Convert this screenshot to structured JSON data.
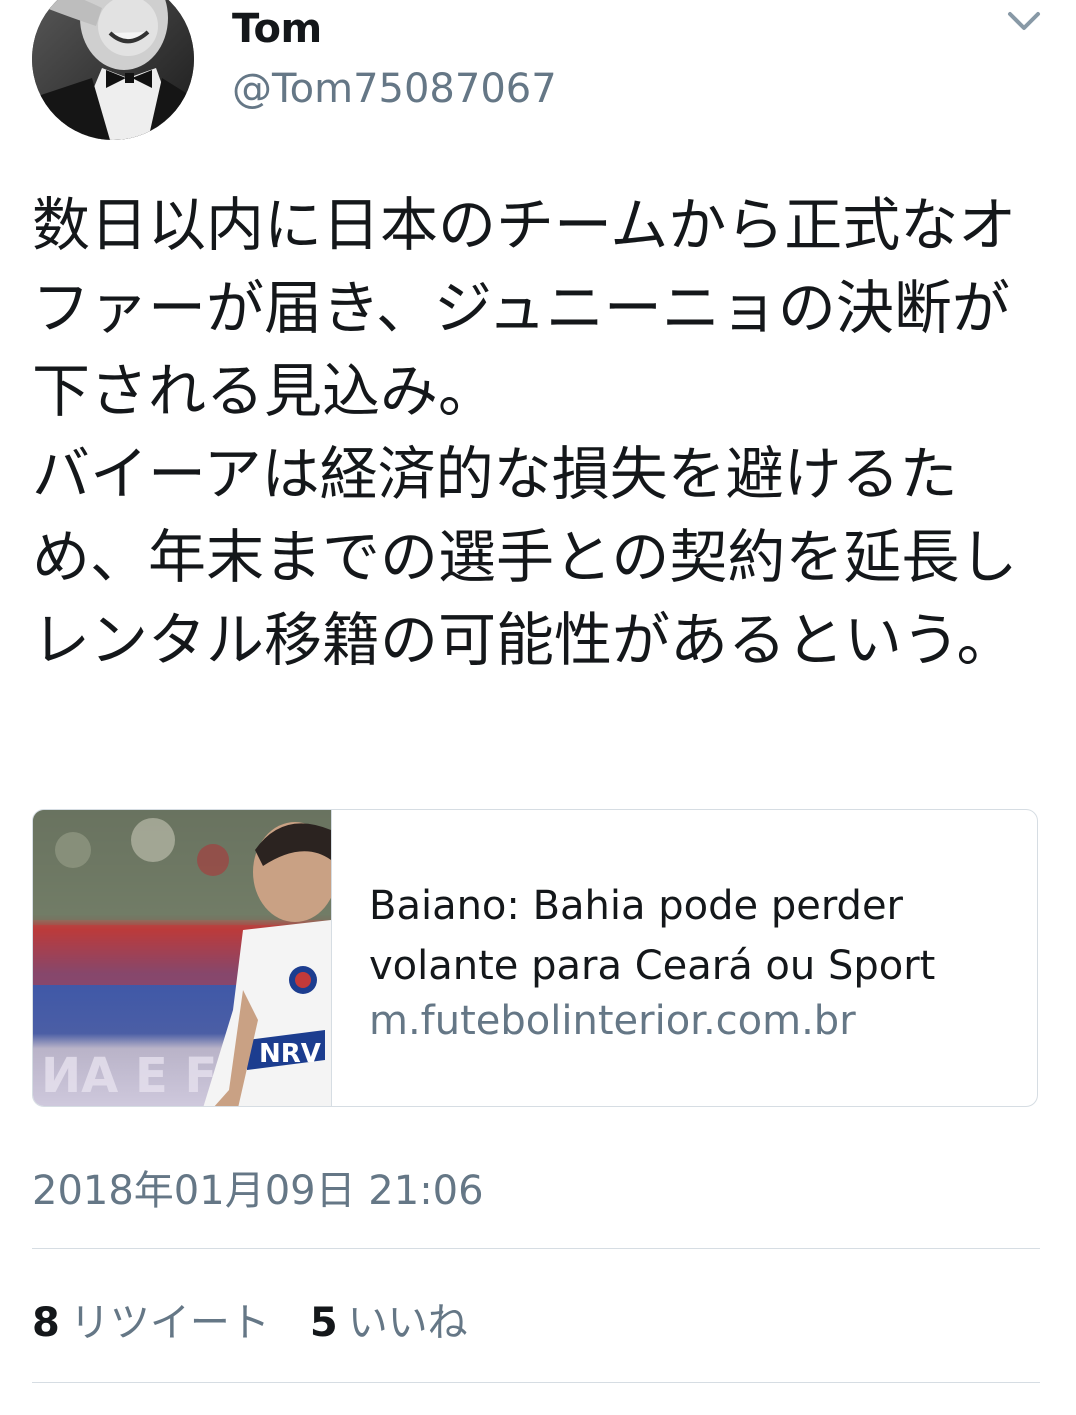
{
  "user": {
    "display_name": "Tom",
    "handle": "@Tom75087067"
  },
  "header": {
    "menu_icon": "chevron-down-icon"
  },
  "tweet": {
    "text": "数日以内に日本のチームから正式なオファーが届き、ジュニーニョの決断が下される見込み。\nバイーアは経済的な損失を避けるため、年末までの選手との契約を延長しレンタル移籍の可能性があるという。"
  },
  "link_card": {
    "title": "Baiano: Bahia pode perder volante para Ceará ou Sport",
    "domain": "m.futebolinterior.com.br"
  },
  "timestamp": "2018年01月09日 21:06",
  "stats": {
    "retweets_count": "8",
    "retweets_label": "リツイート",
    "likes_count": "5",
    "likes_label": "いいね"
  },
  "colors": {
    "primary_text": "#14171a",
    "secondary_text": "#657786",
    "border": "#d6dde3"
  }
}
